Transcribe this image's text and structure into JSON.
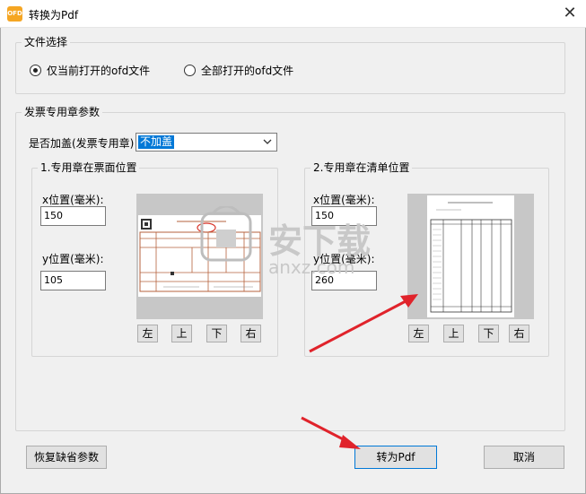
{
  "window": {
    "app_icon_text": "OFD",
    "title": "转换为Pdf",
    "close_glyph": "✕"
  },
  "file_select": {
    "legend": "文件选择",
    "options": [
      {
        "label": "仅当前打开的ofd文件",
        "checked": true
      },
      {
        "label": "全部打开的ofd文件",
        "checked": false
      }
    ]
  },
  "seal_params": {
    "legend": "发票专用章参数",
    "stamp_label": "是否加盖(发票专用章)",
    "stamp_value": "不加盖",
    "invoice_position": {
      "legend": "1.专用章在票面位置",
      "x_label": "x位置(毫米):",
      "x_value": "150",
      "y_label": "y位置(毫米):",
      "y_value": "105",
      "buttons": [
        "左",
        "上",
        "下",
        "右"
      ]
    },
    "list_position": {
      "legend": "2.专用章在清单位置",
      "x_label": "x位置(毫米):",
      "x_value": "150",
      "y_label": "y位置(毫米):",
      "y_value": "260",
      "buttons": [
        "左",
        "上",
        "下",
        "右"
      ]
    }
  },
  "footer": {
    "restore_label": "恢复缺省参数",
    "convert_label": "转为Pdf",
    "cancel_label": "取消"
  },
  "watermark": {
    "text": "安下载",
    "domain": "anxz.com"
  },
  "colors": {
    "accent": "#0078d7",
    "annotation_arrow": "#e0232b",
    "invoice_lines": "#b5623c"
  },
  "icons": {
    "app": "ofd-app-icon",
    "close": "close-icon",
    "dropdown": "chevron-down-icon"
  }
}
